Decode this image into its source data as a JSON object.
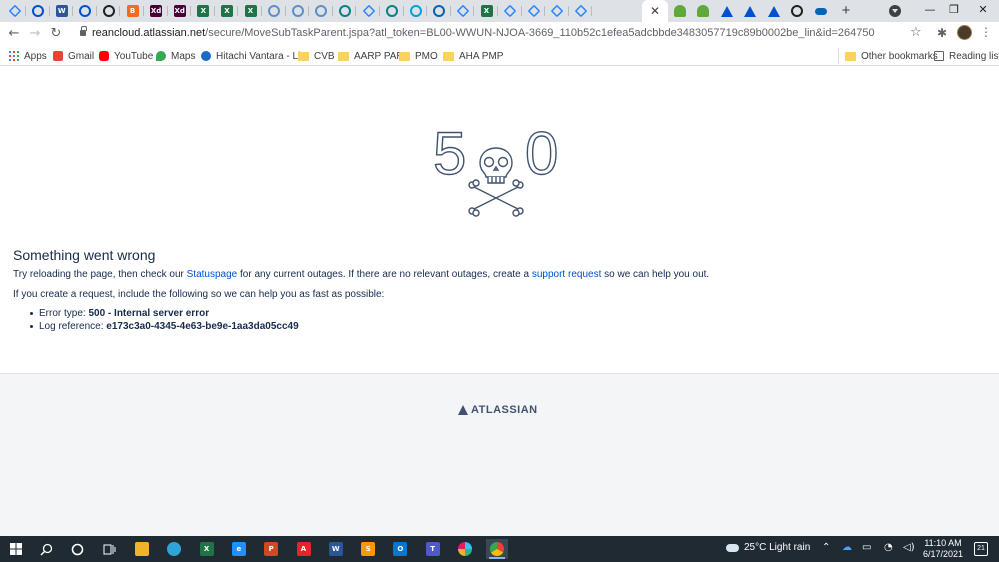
{
  "browser": {
    "tabs": [
      {
        "icon": "jira-icon",
        "color": "#2684ff"
      },
      {
        "icon": "checkmark-icon",
        "color": "#0052cc"
      },
      {
        "icon": "word-icon",
        "color": "#2b579a",
        "glyph": "W"
      },
      {
        "icon": "confluence-icon",
        "color": "#0052cc"
      },
      {
        "icon": "openai-icon",
        "color": "#202124"
      },
      {
        "icon": "orange-b-icon",
        "color": "#f26b21",
        "glyph": "B"
      },
      {
        "icon": "adobe-xd-icon",
        "color": "#470137",
        "glyph": "Xd"
      },
      {
        "icon": "adobe-xd-icon",
        "color": "#470137",
        "glyph": "Xd"
      },
      {
        "icon": "excel-icon",
        "color": "#217346",
        "glyph": "X"
      },
      {
        "icon": "excel-icon",
        "color": "#217346",
        "glyph": "X"
      },
      {
        "icon": "excel-icon",
        "color": "#217346",
        "glyph": "X"
      },
      {
        "icon": "cloud-icon",
        "color": "#5f8fc9"
      },
      {
        "icon": "cloud-icon",
        "color": "#5f8fc9"
      },
      {
        "icon": "cloud-icon",
        "color": "#5f8fc9"
      },
      {
        "icon": "sharepoint-icon",
        "color": "#038387"
      },
      {
        "icon": "jira-icon",
        "color": "#2684ff"
      },
      {
        "icon": "sharepoint-icon",
        "color": "#038387"
      },
      {
        "icon": "salesforce-icon",
        "color": "#00a1e0"
      },
      {
        "icon": "onedrive-icon",
        "color": "#0364b8"
      },
      {
        "icon": "jira-icon",
        "color": "#2684ff"
      },
      {
        "icon": "excel-icon",
        "color": "#217346",
        "glyph": "X"
      },
      {
        "icon": "jira-icon",
        "color": "#2684ff"
      },
      {
        "icon": "jira-icon",
        "color": "#2684ff"
      },
      {
        "icon": "jira-icon",
        "color": "#2684ff"
      },
      {
        "icon": "jira-icon",
        "color": "#2684ff"
      }
    ],
    "active_tab_close": "✕",
    "trailing_tabs": [
      {
        "icon": "green-shield-icon",
        "color": "#5fa83a"
      },
      {
        "icon": "green-shield-icon",
        "color": "#5fa83a"
      },
      {
        "icon": "atlassian-icon",
        "color": "#0052cc"
      },
      {
        "icon": "atlassian-icon",
        "color": "#0052cc"
      },
      {
        "icon": "atlassian-icon",
        "color": "#0052cc"
      },
      {
        "icon": "openai-icon",
        "color": "#202124"
      },
      {
        "icon": "onedrive-icon",
        "color": "#0364b8"
      }
    ],
    "new_tab": "+",
    "window_controls": {
      "minimize": "—",
      "maximize": "❐",
      "close": "✕"
    },
    "nav": {
      "back": "←",
      "forward": "→",
      "reload": "↻"
    },
    "url": {
      "host": "reancloud.atlassian.net",
      "path": "/secure/MoveSubTaskParent.jspa?atl_token=BL00-WWUN-NJOA-3669_110b52c1efea5adcbbde3483057719c89b0002be_lin&id=264750"
    },
    "star": "☆",
    "extensions": "✱",
    "menu": "⋮"
  },
  "bookmarks": [
    {
      "label": "Apps",
      "icon": "apps-grid-icon"
    },
    {
      "label": "Gmail",
      "icon": "gmail-icon",
      "color": "#ea4335"
    },
    {
      "label": "YouTube",
      "icon": "youtube-icon",
      "color": "#ff0000"
    },
    {
      "label": "Maps",
      "icon": "maps-icon",
      "color": "#34a853"
    },
    {
      "label": "Hitachi Vantara - Li...",
      "icon": "hitachi-icon",
      "color": "#1b6ac9"
    },
    {
      "label": "CVB",
      "icon": "folder-icon"
    },
    {
      "label": "AARP PAR",
      "icon": "folder-icon"
    },
    {
      "label": "PMO",
      "icon": "folder-icon"
    },
    {
      "label": "AHA PMP",
      "icon": "folder-icon"
    }
  ],
  "bookmarks_right": [
    {
      "label": "Other bookmarks",
      "icon": "folder-icon"
    },
    {
      "label": "Reading list",
      "icon": "reading-list-icon"
    }
  ],
  "error_page": {
    "digit_left": "5",
    "digit_right": "0",
    "title": "Something went wrong",
    "desc_before": "Try reloading the page, then check our ",
    "statuspage_link": "Statuspage",
    "desc_middle": " for any current outages. If there are no relevant outages, create a ",
    "support_link": "support request",
    "desc_after": " so we can help you out.",
    "intro": "If you create a request, include the following so we can help you as fast as possible:",
    "details": [
      {
        "label": "Error type: ",
        "value": "500 - Internal server error"
      },
      {
        "label": "Log reference: ",
        "value": "e173c3a0-4345-4e63-be9e-1aa3da05cc49"
      }
    ],
    "footer_logo": "ATLASSIAN"
  },
  "taskbar": {
    "apps": [
      {
        "icon": "file-explorer-icon",
        "color": "#f0b429"
      },
      {
        "icon": "edge-chromium-icon",
        "color": "#2fa4d9"
      },
      {
        "icon": "excel-icon",
        "color": "#217346",
        "glyph": "X"
      },
      {
        "icon": "internet-explorer-icon",
        "color": "#1e90ff",
        "glyph": "e"
      },
      {
        "icon": "powerpoint-icon",
        "color": "#d24726",
        "glyph": "P"
      },
      {
        "icon": "acrobat-icon",
        "color": "#e5252a",
        "glyph": "A"
      },
      {
        "icon": "word-icon",
        "color": "#2b579a",
        "glyph": "W"
      },
      {
        "icon": "sublime-icon",
        "color": "#ff9800",
        "glyph": "S"
      },
      {
        "icon": "outlook-icon",
        "color": "#0078d4",
        "glyph": "O"
      },
      {
        "icon": "teams-icon",
        "color": "#5059c9",
        "glyph": "T"
      },
      {
        "icon": "slack-icon",
        "color": "#ffffff"
      },
      {
        "icon": "chrome-icon",
        "color": "#fbbc05"
      }
    ],
    "weather": "25°C  Light rain",
    "time": "11:10 AM",
    "date": "6/17/2021",
    "notifications": "21"
  }
}
